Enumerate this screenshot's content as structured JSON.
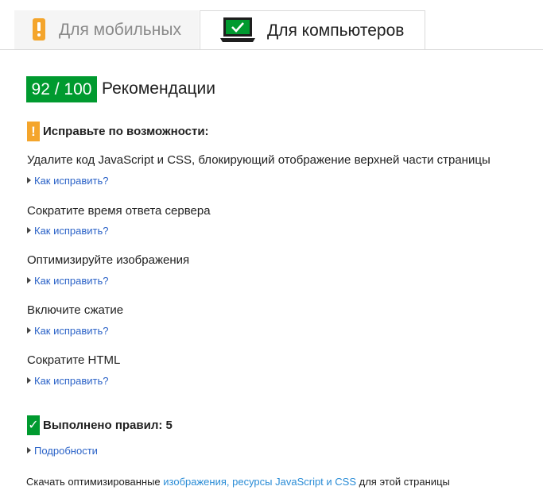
{
  "tabs": {
    "mobile_label": "Для мобильных",
    "desktop_label": "Для компьютеров",
    "active": "desktop"
  },
  "score": {
    "badge": "92 / 100",
    "title": "Рекомендации"
  },
  "fix_section": {
    "icon_text": "!",
    "title": "Исправьте по возможности:",
    "rules": [
      {
        "title": "Удалите код JavaScript и CSS, блокирующий отображение верхней части страницы",
        "link": "Как исправить?"
      },
      {
        "title": "Сократите время ответа сервера",
        "link": "Как исправить?"
      },
      {
        "title": "Оптимизируйте изображения",
        "link": "Как исправить?"
      },
      {
        "title": "Включите сжатие",
        "link": "Как исправить?"
      },
      {
        "title": "Сократите HTML",
        "link": "Как исправить?"
      }
    ]
  },
  "passed_section": {
    "icon_text": "✓",
    "title": "Выполнено правил: 5",
    "link": "Подробности"
  },
  "footer": {
    "prefix": "Скачать оптимизированные ",
    "link": "изображения, ресурсы JavaScript и CSS",
    "suffix": " для этой страницы"
  },
  "colors": {
    "score_green": "#009a2f",
    "warning_orange": "#f4a52c",
    "link_blue": "#2a62c7",
    "footer_link": "#2a8cd6"
  },
  "icons": [
    "phone-icon",
    "laptop-check-icon",
    "warning-icon",
    "check-icon",
    "expand-triangle-icon"
  ]
}
